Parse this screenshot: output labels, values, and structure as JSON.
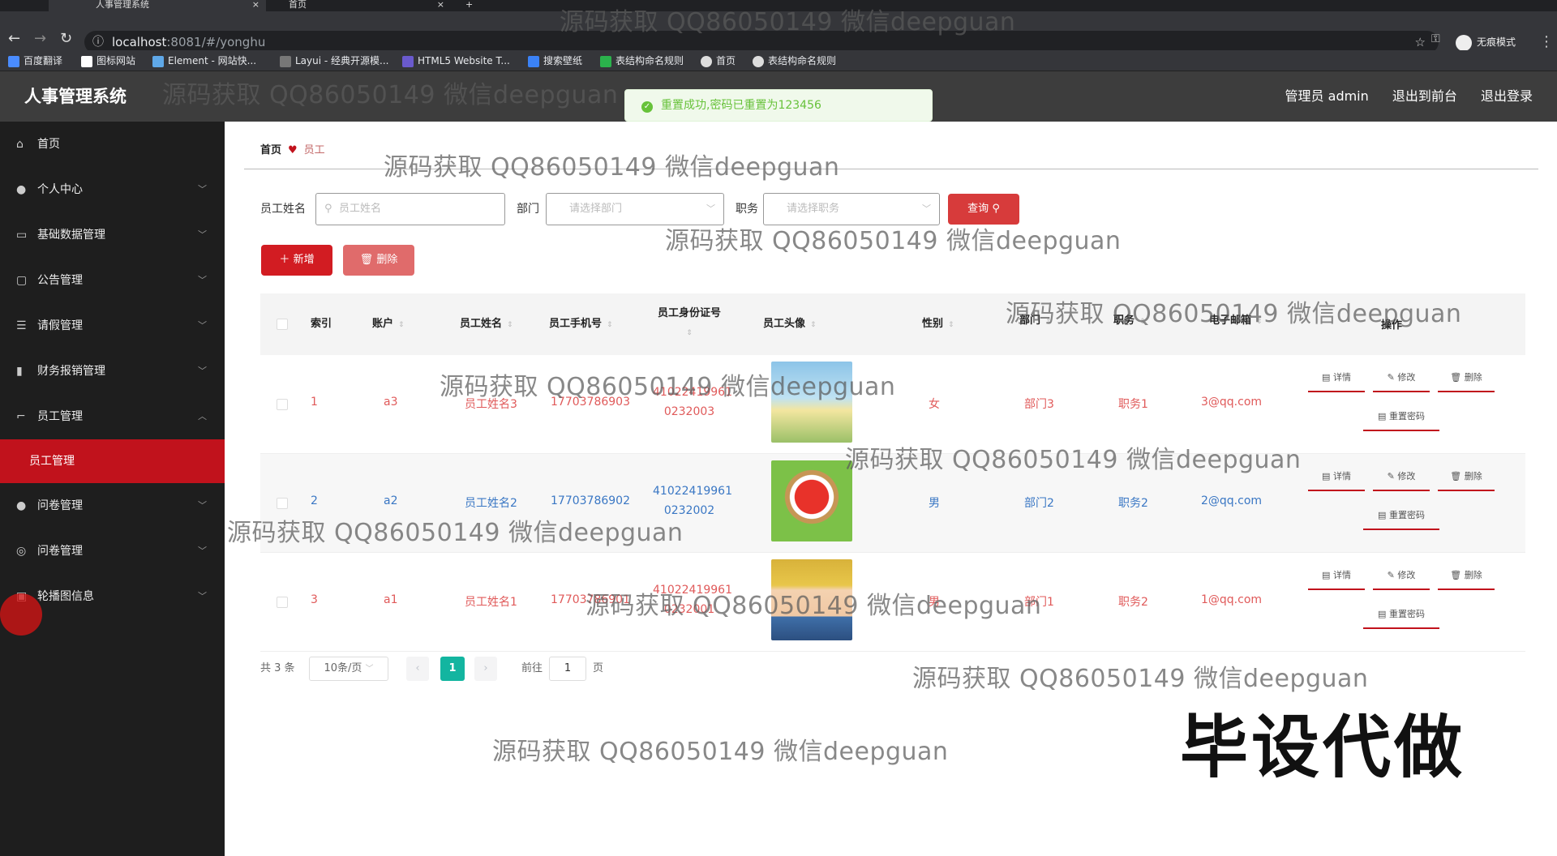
{
  "browser": {
    "tabs": [
      {
        "title": "人事管理系统",
        "active": true
      },
      {
        "title": "首页",
        "active": false
      }
    ],
    "url_host": "localhost",
    "url_rest": ":8081/#/yonghu",
    "profile_label": "无痕模式",
    "bookmarks": [
      "百度翻译",
      "图标网站",
      "Element - 网站快...",
      "Layui - 经典开源模...",
      "HTML5 Website T...",
      "搜索壁纸",
      "表结构命名规则",
      "首页",
      "表结构命名规则"
    ]
  },
  "header": {
    "title": "人事管理系统",
    "admin_label": "管理员 admin",
    "to_front_label": "退出到前台",
    "logout_label": "退出登录"
  },
  "toast": {
    "message": "重置成功,密码已重置为123456"
  },
  "sidebar": {
    "items": [
      {
        "label": "首页",
        "icon": "home-icon"
      },
      {
        "label": "个人中心",
        "icon": "user-icon"
      },
      {
        "label": "基础数据管理",
        "icon": "monitor-icon"
      },
      {
        "label": "公告管理",
        "icon": "message-icon"
      },
      {
        "label": "请假管理",
        "icon": "list-icon"
      },
      {
        "label": "财务报销管理",
        "icon": "chart-icon"
      },
      {
        "label": "员工管理",
        "icon": "crop-icon"
      },
      {
        "label": "问卷管理",
        "icon": "user-icon"
      },
      {
        "label": "问卷管理",
        "icon": "radar-icon"
      },
      {
        "label": "轮播图信息",
        "icon": "calendar-icon"
      }
    ],
    "active_sub": "员工管理"
  },
  "breadcrumb": {
    "home": "首页",
    "current": "员工"
  },
  "filters": {
    "name_label": "员工姓名",
    "name_placeholder": "员工姓名",
    "dept_label": "部门",
    "dept_placeholder": "请选择部门",
    "post_label": "职务",
    "post_placeholder": "请选择职务",
    "query_label": "查询"
  },
  "actions": {
    "add_label": "新增",
    "delete_label": "删除"
  },
  "table": {
    "headers": {
      "index": "索引",
      "account": "账户",
      "name": "员工姓名",
      "phone": "员工手机号",
      "idcard": "员工身份证号",
      "avatar": "员工头像",
      "gender": "性别",
      "dept": "部门",
      "post": "职务",
      "email": "电子邮箱",
      "ops": "操作"
    },
    "rows": [
      {
        "index": "1",
        "account": "a3",
        "name": "员工姓名3",
        "phone": "17703786903",
        "idcard_1": "41022419961",
        "idcard_2": "0232003",
        "gender": "女",
        "dept": "部门3",
        "post": "职务1",
        "email": "3@qq.com"
      },
      {
        "index": "2",
        "account": "a2",
        "name": "员工姓名2",
        "phone": "17703786902",
        "idcard_1": "41022419961",
        "idcard_2": "0232002",
        "gender": "男",
        "dept": "部门2",
        "post": "职务2",
        "email": "2@qq.com"
      },
      {
        "index": "3",
        "account": "a1",
        "name": "员工姓名1",
        "phone": "17703786901",
        "idcard_1": "41022419961",
        "idcard_2": "0232001",
        "gender": "男",
        "dept": "部门1",
        "post": "职务2",
        "email": "1@qq.com"
      }
    ],
    "ops": {
      "detail": "详情",
      "edit": "修改",
      "delete": "删除",
      "reset": "重置密码"
    }
  },
  "pager": {
    "total": "共 3 条",
    "page_size": "10条/页",
    "current_page": "1",
    "goto_label": "前往",
    "goto_value": "1",
    "page_unit": "页"
  },
  "watermark": {
    "text": "源码获取 QQ86050149 微信deepguan",
    "big": "毕设代做"
  },
  "colors": {
    "accent": "#c1121c",
    "sidebar": "#1e1e1e",
    "header": "#3d3d3d",
    "pager_current": "#13b5a0"
  }
}
